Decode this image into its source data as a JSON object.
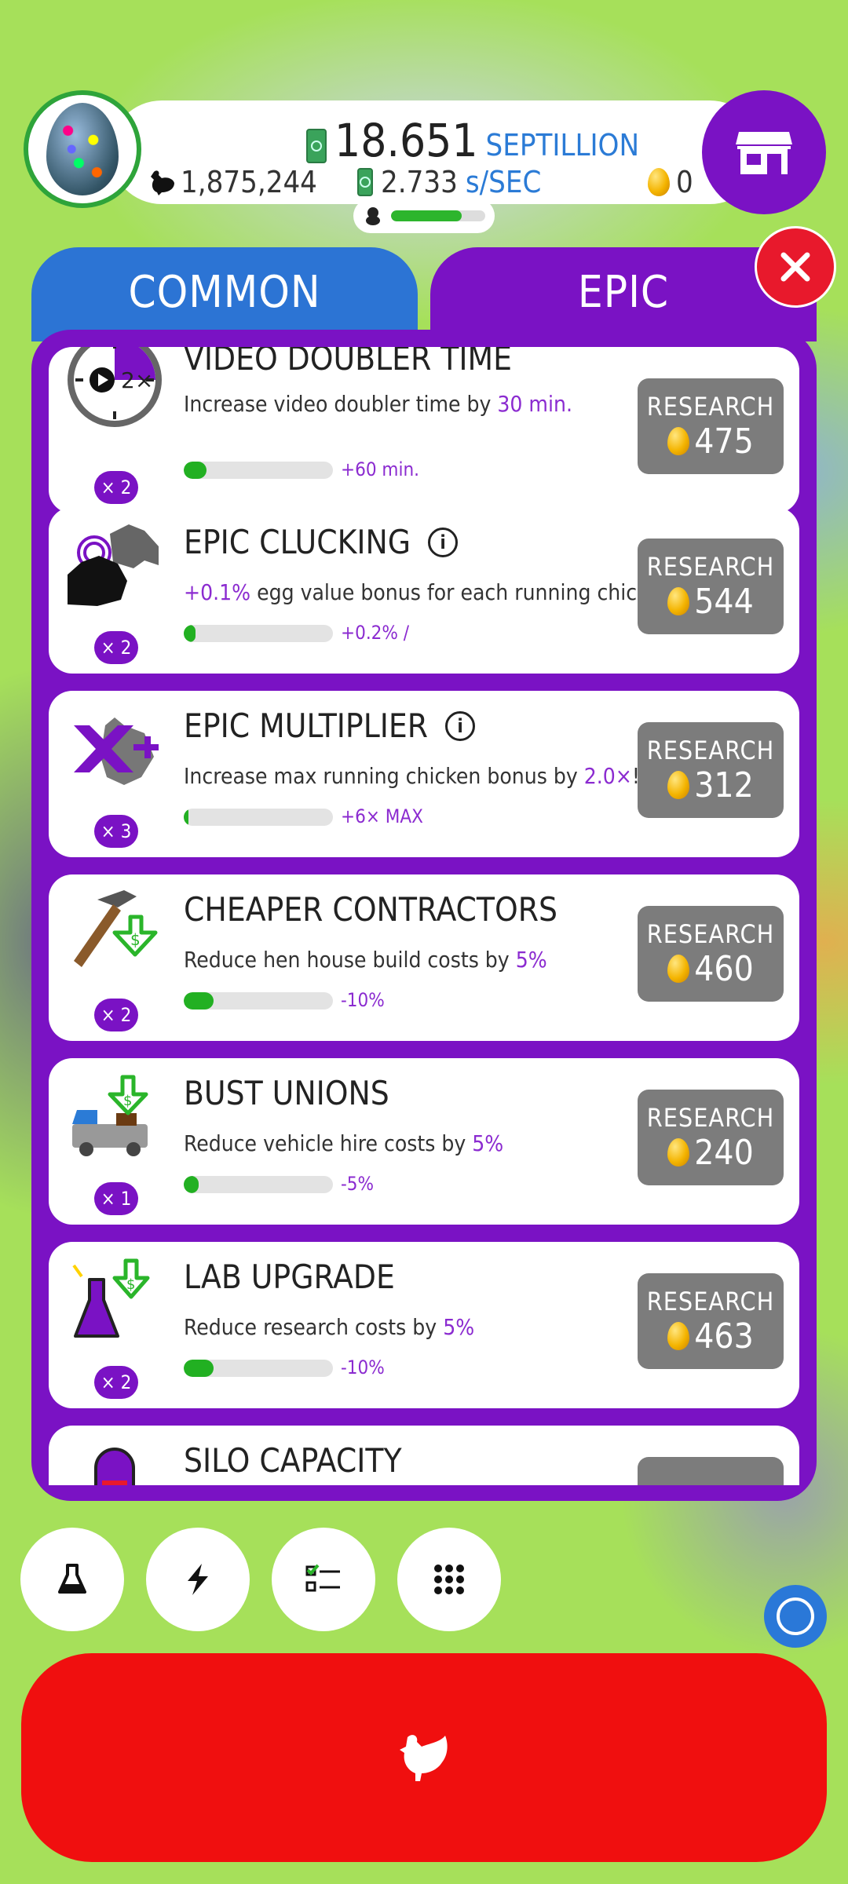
{
  "hud": {
    "money_value": "18.651",
    "money_unit": "SEPTILLION",
    "rate_value": "2.733",
    "rate_unit": "s/SEC",
    "chicken_count": "1,875,244",
    "golden_eggs": "0",
    "drone_progress": 0.75
  },
  "tabs": {
    "common": "COMMON",
    "epic": "EPIC",
    "active": "epic"
  },
  "colors": {
    "epic_purple": "#7a12c4",
    "common_blue": "#2c74d4",
    "progress_green": "#22b022",
    "close_red": "#e8192c"
  },
  "research": [
    {
      "icon": "stopwatch-icon",
      "title": "VIDEO DOUBLER TIME",
      "desc_before": "Increase video doubler time by ",
      "desc_highlight": "30 min.",
      "desc_after": "",
      "multiplier": "× 2",
      "progress": 0.15,
      "next": "+60 min.",
      "button_label": "RESEARCH",
      "cost": "475",
      "has_info": false
    },
    {
      "icon": "clucking-chicken-icon",
      "title": "EPIC CLUCKING",
      "desc_before": "",
      "desc_highlight": "+0.1%",
      "desc_after": " egg value bonus for each running chicken.",
      "multiplier": "× 2",
      "progress": 0.08,
      "next": "+0.2% /",
      "button_label": "RESEARCH",
      "cost": "544",
      "has_info": true
    },
    {
      "icon": "chicken-multiplier-icon",
      "title": "EPIC MULTIPLIER",
      "desc_before": "Increase max running chicken bonus by ",
      "desc_highlight": "2.0×",
      "desc_after": "!",
      "multiplier": "× 3",
      "progress": 0.03,
      "next": "+6× MAX",
      "button_label": "RESEARCH",
      "cost": "312",
      "has_info": true
    },
    {
      "icon": "hammer-discount-icon",
      "title": "CHEAPER CONTRACTORS",
      "desc_before": "Reduce hen house build costs by ",
      "desc_highlight": "5%",
      "desc_after": "",
      "multiplier": "× 2",
      "progress": 0.2,
      "next": "-10%",
      "button_label": "RESEARCH",
      "cost": "460",
      "has_info": false
    },
    {
      "icon": "truck-discount-icon",
      "title": "BUST UNIONS",
      "desc_before": "Reduce vehicle hire costs by ",
      "desc_highlight": "5%",
      "desc_after": "",
      "multiplier": "× 1",
      "progress": 0.1,
      "next": "-5%",
      "button_label": "RESEARCH",
      "cost": "240",
      "has_info": false
    },
    {
      "icon": "flask-discount-icon",
      "title": "LAB UPGRADE",
      "desc_before": "Reduce research costs by ",
      "desc_highlight": "5%",
      "desc_after": "",
      "multiplier": "× 2",
      "progress": 0.2,
      "next": "-10%",
      "button_label": "RESEARCH",
      "cost": "463",
      "has_info": false
    },
    {
      "icon": "silo-icon",
      "title": "SILO CAPACITY",
      "desc_before": "",
      "desc_highlight": "",
      "desc_after": "",
      "multiplier": "",
      "progress": 0,
      "next": "",
      "button_label": "",
      "cost": "",
      "has_info": false
    }
  ],
  "bottom_buttons": [
    "flask-icon",
    "lightning-icon",
    "checklist-icon",
    "grid-menu-icon"
  ]
}
